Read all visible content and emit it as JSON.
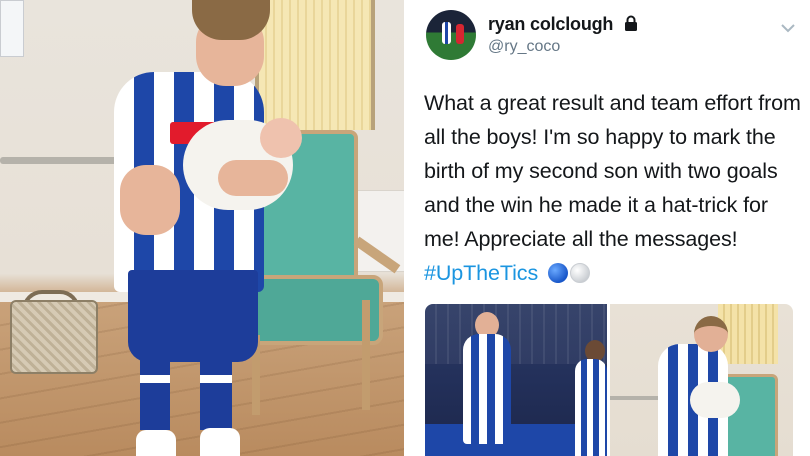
{
  "tweet": {
    "display_name": "ryan colclough",
    "handle": "@ry_coco",
    "text_main": "What a great result and team effort from all the boys! I'm so happy to mark the birth of my second son with two goals and the win he made it a hat-trick for me! Appreciate all the messages! ",
    "hashtag": "#UpTheTics",
    "icons": {
      "lock": "lock-icon",
      "menu": "chevron-down-icon"
    }
  },
  "colors": {
    "text": "#14171a",
    "secondary": "#657786",
    "link": "#1b95e0",
    "kit_blue": "#1e47a8"
  }
}
